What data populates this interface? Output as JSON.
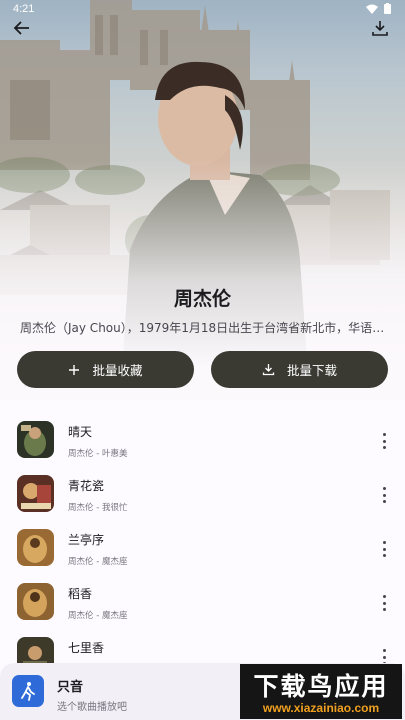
{
  "status_bar": {
    "time": "4:21"
  },
  "artist": {
    "name": "周杰伦",
    "description": "周杰伦（Jay Chou），1979年1月18日出生于台湾省新北市，华语流..."
  },
  "actions": {
    "collect_label": "批量收藏",
    "download_label": "批量下载"
  },
  "songs": [
    {
      "title": "晴天",
      "subtitle": "周杰伦 - 叶惠美"
    },
    {
      "title": "青花瓷",
      "subtitle": "周杰伦 - 我很忙"
    },
    {
      "title": "兰亭序",
      "subtitle": "周杰伦 - 魔杰座"
    },
    {
      "title": "稻香",
      "subtitle": "周杰伦 - 魔杰座"
    },
    {
      "title": "七里香",
      "subtitle": ""
    }
  ],
  "player": {
    "title": "只音",
    "subtitle": "选个歌曲播放吧"
  },
  "watermark": {
    "title": "下载鸟应用",
    "url": "www.xiazainiao.com"
  },
  "colors": {
    "button_bg": "#3a3a33",
    "player_icon": "#2f6bd8",
    "watermark_url": "#f0a020"
  },
  "icons": {
    "back": "arrow-left-icon",
    "download_top": "download-icon",
    "plus": "plus-icon",
    "download_btn": "download-icon",
    "more": "more-vertical-icon"
  }
}
